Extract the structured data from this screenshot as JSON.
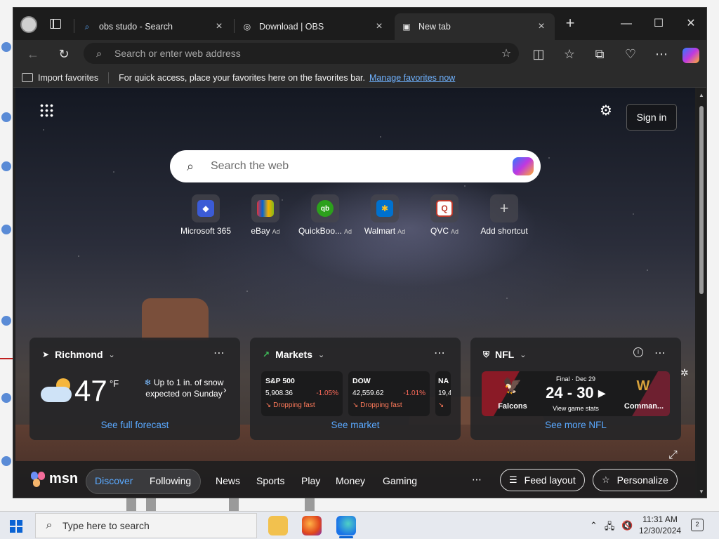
{
  "tabs": [
    {
      "title": "obs studo - Search",
      "icon": "search-icon"
    },
    {
      "title": "Download | OBS",
      "icon": "obs-icon"
    },
    {
      "title": "New tab",
      "icon": "newtab-icon",
      "active": true
    }
  ],
  "toolbar": {
    "address_placeholder": "Search or enter web address"
  },
  "favorites_bar": {
    "import_label": "Import favorites",
    "message": "For quick access, place your favorites here on the favorites bar.",
    "manage_link": "Manage favorites now"
  },
  "newtab": {
    "signin_label": "Sign in",
    "search_placeholder": "Search the web",
    "shortcuts": [
      {
        "label": "Microsoft 365",
        "ad": "",
        "color": "#3b5bd6",
        "glyph": "◆"
      },
      {
        "label": "eBay",
        "ad": "Ad",
        "color": "#e53238",
        "glyph": "🛍"
      },
      {
        "label": "QuickBoo...",
        "ad": "Ad",
        "color": "#2ca01c",
        "glyph": "qb"
      },
      {
        "label": "Walmart",
        "ad": "Ad",
        "color": "#0071ce",
        "glyph": "✱"
      },
      {
        "label": "QVC",
        "ad": "Ad",
        "color": "#ffffff",
        "glyph": "Q"
      },
      {
        "label": "Add shortcut",
        "ad": "",
        "color": "",
        "glyph": "+"
      }
    ]
  },
  "weather": {
    "location": "Richmond",
    "temperature": "47",
    "unit": "°F",
    "alert": "Up to 1 in. of snow expected on Sunday",
    "footer": "See full forecast"
  },
  "markets": {
    "title": "Markets",
    "items": [
      {
        "name": "S&P 500",
        "value": "5,908.36",
        "change": "-1.05%",
        "note": "Dropping fast"
      },
      {
        "name": "DOW",
        "value": "42,559.62",
        "change": "-1.01%",
        "note": "Dropping fast"
      },
      {
        "name": "NA",
        "value": "19,4",
        "change": "",
        "note": ""
      }
    ],
    "footer": "See market"
  },
  "nfl": {
    "title": "NFL",
    "status": "Final · Dec 29",
    "score": "24 - 30",
    "stats_label": "View game stats",
    "team_left": "Falcons",
    "team_right": "Comman...",
    "footer": "See more NFL"
  },
  "msn_nav": {
    "logo": "msn",
    "items": [
      "Discover",
      "Following",
      "News",
      "Sports",
      "Play",
      "Money",
      "Gaming"
    ],
    "feed_layout": "Feed layout",
    "personalize": "Personalize"
  },
  "taskbar": {
    "search_placeholder": "Type here to search",
    "time": "11:31 AM",
    "date": "12/30/2024",
    "notifications": "2"
  }
}
